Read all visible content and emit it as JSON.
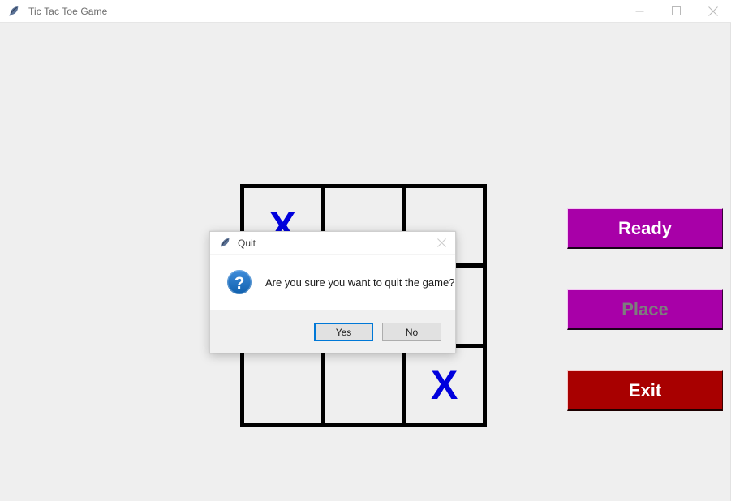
{
  "window": {
    "title": "Tic Tac Toe Game",
    "icon": "feather-icon",
    "background_color": "#efefef",
    "controls": [
      {
        "name": "minimize",
        "glyph": "minimize-icon"
      },
      {
        "name": "maximize",
        "glyph": "maximize-icon"
      },
      {
        "name": "close",
        "glyph": "close-icon"
      }
    ]
  },
  "board": {
    "rows": 3,
    "columns": 3,
    "line_color": "#000000",
    "cell_color": "#efefef",
    "mark_color": "#0000dd",
    "cells": [
      {
        "index": 0,
        "mark": "X"
      },
      {
        "index": 1,
        "mark": ""
      },
      {
        "index": 2,
        "mark": ""
      },
      {
        "index": 3,
        "mark": ""
      },
      {
        "index": 4,
        "mark": ""
      },
      {
        "index": 5,
        "mark": ""
      },
      {
        "index": 6,
        "mark": ""
      },
      {
        "index": 7,
        "mark": ""
      },
      {
        "index": 8,
        "mark": "X"
      }
    ]
  },
  "side_panel": {
    "ready": {
      "label": "Ready",
      "color": "#a800a8",
      "text_color": "#ffffff",
      "enabled": true
    },
    "place": {
      "label": "Place",
      "color": "#a800a8",
      "text_color": "#7d7d7d",
      "enabled": false
    },
    "exit": {
      "label": "Exit",
      "color": "#a80000",
      "text_color": "#ffffff",
      "enabled": true
    }
  },
  "dialog": {
    "title": "Quit",
    "icon": "feather-icon",
    "message": "Are you sure you want to quit the game?",
    "message_icon": "question-icon",
    "message_icon_color": "#1b6ec2",
    "close_glyph": "close-icon",
    "focus_color": "#0078d7",
    "buttons": [
      {
        "label": "Yes",
        "focused": true
      },
      {
        "label": "No",
        "focused": false
      }
    ]
  }
}
